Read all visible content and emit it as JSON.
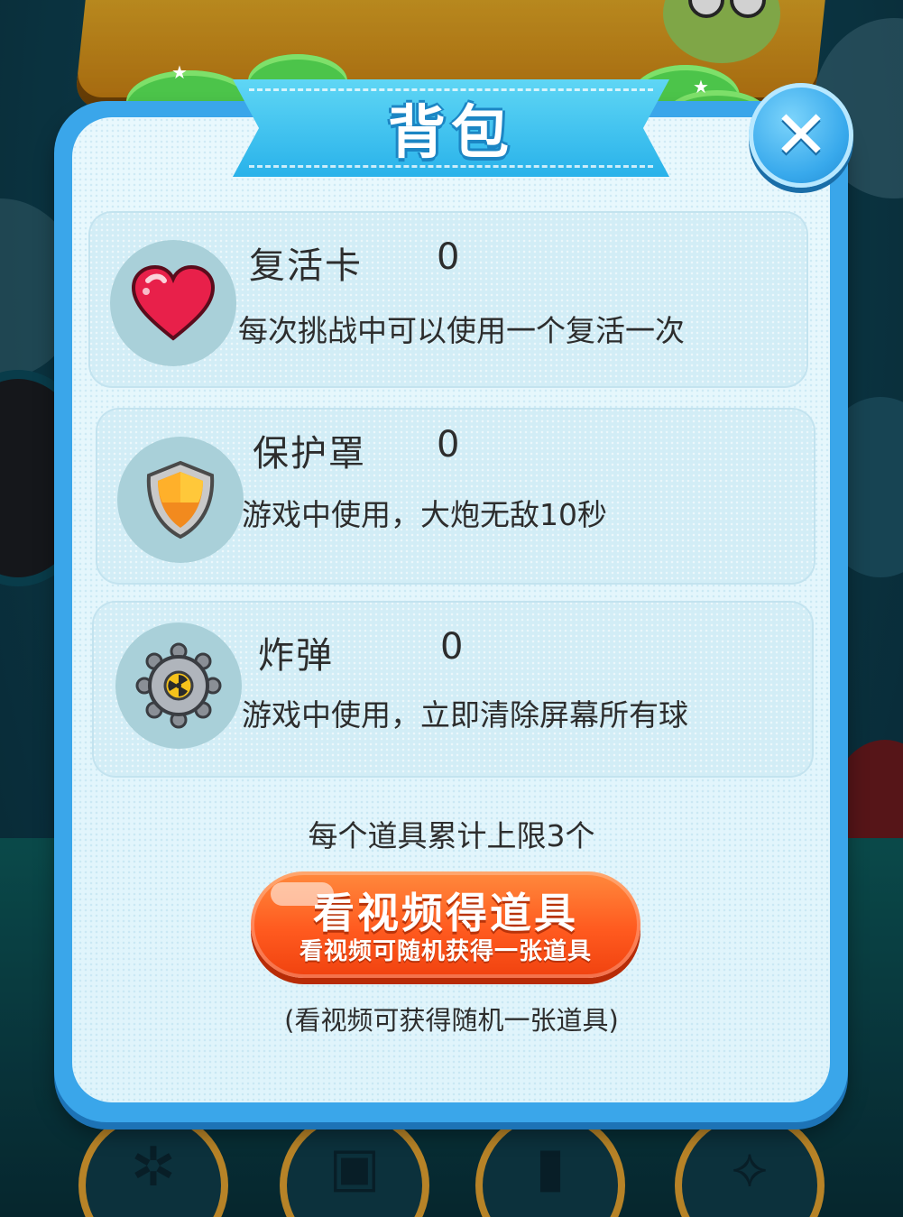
{
  "dialog": {
    "title": "背包",
    "close_icon": "close-icon"
  },
  "items": [
    {
      "name": "复活卡",
      "count": "0",
      "description": "每次挑战中可以使用一个复活一次",
      "icon": "heart-icon"
    },
    {
      "name": "保护罩",
      "count": "0",
      "description": "游戏中使用，大炮无敌10秒",
      "icon": "shield-icon"
    },
    {
      "name": "炸弹",
      "count": "0",
      "description": "游戏中使用，立即清除屏幕所有球",
      "icon": "bomb-icon"
    }
  ],
  "limit_text": "每个道具累计上限3个",
  "video_button": {
    "label": "看视频得道具",
    "sublabel": "看视频可随机获得一张道具"
  },
  "hint_text": "(看视频可获得随机一张道具)",
  "colors": {
    "panel_border": "#3aa6ea",
    "panel_fill": "#e9f8fd",
    "card_fill": "#d2edf6",
    "button_orange": "#ff5a1f",
    "title_ribbon": "#29b2ea"
  }
}
